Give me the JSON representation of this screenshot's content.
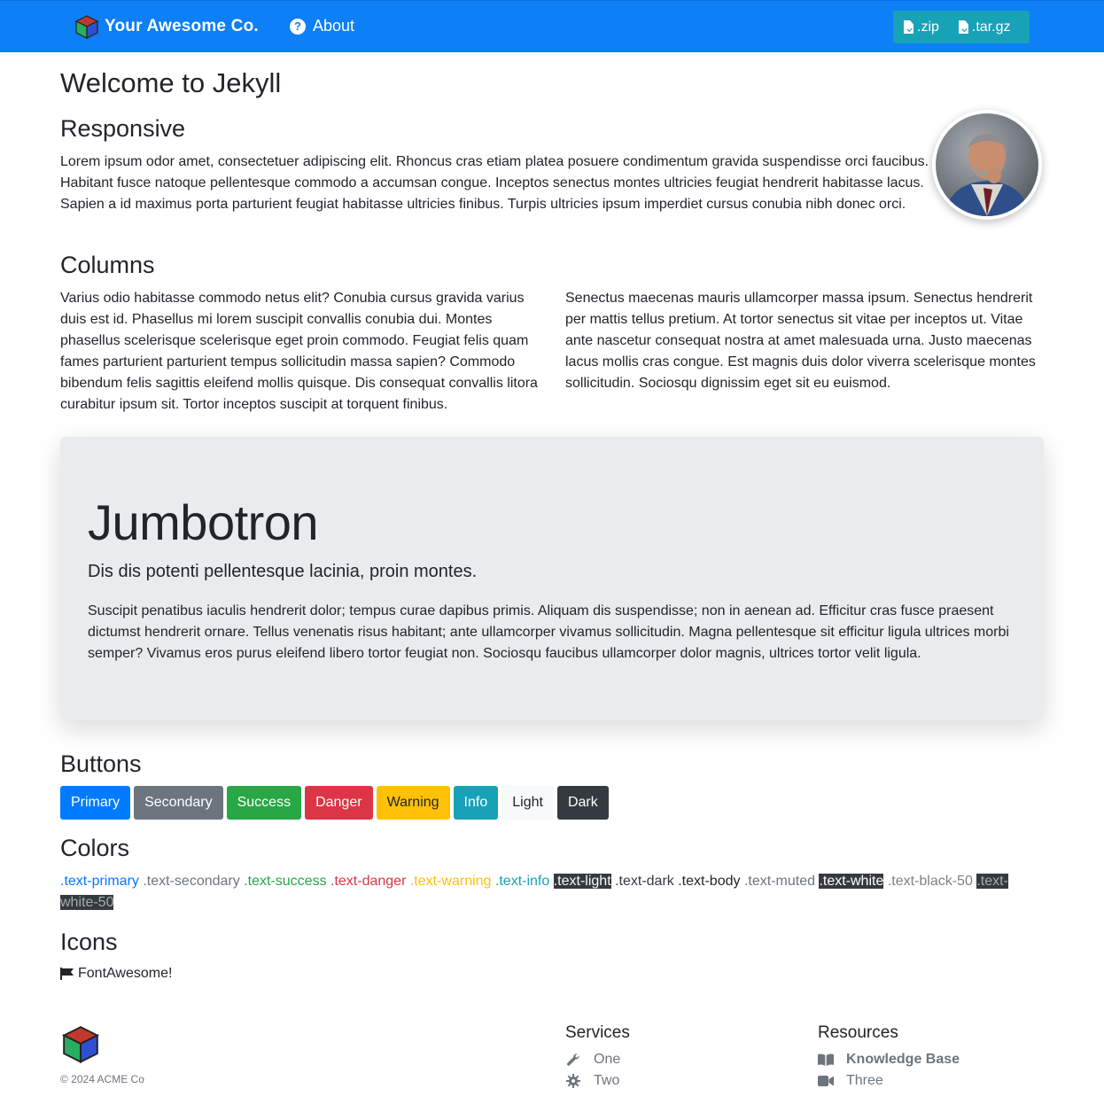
{
  "navbar": {
    "brand": "Your Awesome Co.",
    "about": "About",
    "downloads": [
      ".zip",
      ".tar.gz"
    ]
  },
  "page": {
    "title": "Welcome to Jekyll",
    "responsive_heading": "Responsive",
    "responsive_text": "Lorem ipsum odor amet, consectetuer adipiscing elit. Rhoncus cras etiam platea posuere condimentum gravida suspendisse orci faucibus. Habitant fusce natoque pellentesque commodo a accumsan congue. Inceptos senectus montes ultricies feugiat hendrerit habitasse lacus. Sapien a id maximus porta parturient feugiat habitasse ultricies finibus. Turpis ultricies ipsum imperdiet cursus conubia nibh donec orci.",
    "columns_heading": "Columns",
    "column1": "Varius odio habitasse commodo netus elit? Conubia cursus gravida varius duis est id. Phasellus mi lorem suscipit convallis conubia dui. Montes phasellus scelerisque scelerisque eget proin commodo. Feugiat felis quam fames parturient parturient tempus sollicitudin massa sapien? Commodo bibendum felis sagittis eleifend mollis quisque. Dis consequat convallis litora curabitur ipsum sit. Tortor inceptos suscipit at torquent finibus.",
    "column2": "Senectus maecenas mauris ullamcorper massa ipsum. Senectus hendrerit per mattis tellus pretium. At tortor senectus sit vitae per inceptos ut. Vitae ante nascetur consequat nostra at amet malesuada urna. Justo maecenas lacus mollis cras congue. Est magnis duis dolor viverra scelerisque montes sollicitudin. Sociosqu dignissim eget sit eu euismod."
  },
  "jumbotron": {
    "title": "Jumbotron",
    "lead": "Dis dis potenti pellentesque lacinia, proin montes.",
    "text": "Suscipit penatibus iaculis hendrerit dolor; tempus curae dapibus primis. Aliquam dis suspendisse; non in aenean ad. Efficitur cras fusce praesent dictumst hendrerit ornare. Tellus venenatis risus habitant; ante ullamcorper vivamus sollicitudin. Magna pellentesque sit efficitur ligula ultrices morbi semper? Vivamus eros purus eleifend libero tortor feugiat non. Sociosqu faucibus ullamcorper dolor magnis, ultrices tortor velit ligula."
  },
  "buttons": {
    "heading": "Buttons",
    "items": [
      {
        "label": "Primary",
        "bg": "#007bff",
        "fg": "#ffffff"
      },
      {
        "label": "Secondary",
        "bg": "#6c757d",
        "fg": "#ffffff"
      },
      {
        "label": "Success",
        "bg": "#28a745",
        "fg": "#ffffff"
      },
      {
        "label": "Danger",
        "bg": "#dc3545",
        "fg": "#ffffff"
      },
      {
        "label": "Warning",
        "bg": "#ffc107",
        "fg": "#212529"
      },
      {
        "label": "Info",
        "bg": "#17a2b8",
        "fg": "#ffffff"
      },
      {
        "label": "Light",
        "bg": "#f8f9fa",
        "fg": "#212529"
      },
      {
        "label": "Dark",
        "bg": "#343a40",
        "fg": "#ffffff"
      }
    ]
  },
  "colors": {
    "heading": "Colors",
    "items": [
      {
        "label": ".text-primary",
        "color": "#007bff"
      },
      {
        "label": ".text-secondary",
        "color": "#6c757d"
      },
      {
        "label": ".text-success",
        "color": "#28a745"
      },
      {
        "label": ".text-danger",
        "color": "#dc3545"
      },
      {
        "label": ".text-warning",
        "color": "#ffc107"
      },
      {
        "label": ".text-info",
        "color": "#17a2b8"
      },
      {
        "label": ".text-light",
        "color": "#f8f9fa",
        "dark": true
      },
      {
        "label": ".text-dark",
        "color": "#343a40"
      },
      {
        "label": ".text-body",
        "color": "#212529"
      },
      {
        "label": ".text-muted",
        "color": "#6c757d"
      },
      {
        "label": ".text-white",
        "color": "#ffffff",
        "dark": true
      },
      {
        "label": ".text-black-50",
        "color": "#808080"
      },
      {
        "label": ".text-white-50",
        "color": "#a9acaf",
        "dark": true
      }
    ]
  },
  "icons": {
    "heading": "Icons",
    "label": "FontAwesome!",
    "icon": "flag-icon"
  },
  "footer": {
    "copyright": "© 2024 ACME Co",
    "services_heading": "Services",
    "services": [
      {
        "label": "One",
        "icon": "wrench-icon"
      },
      {
        "label": "Two",
        "icon": "gear-icon"
      }
    ],
    "resources_heading": "Resources",
    "resources": [
      {
        "label": "Knowledge Base",
        "icon": "book-icon"
      },
      {
        "label": "Three",
        "icon": "video-icon"
      }
    ]
  }
}
